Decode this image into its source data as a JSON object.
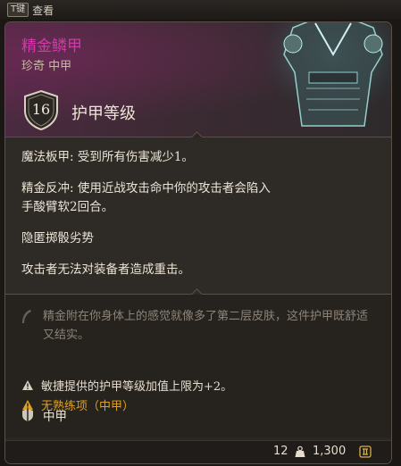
{
  "topbar": {
    "key": "T键",
    "action": "查看"
  },
  "item": {
    "name": "精金鳞甲",
    "rarity_type": "珍奇 中甲",
    "armor_class": "16",
    "armor_class_label": "护甲等级"
  },
  "properties": [
    "魔法板甲: 受到所有伤害减少1。",
    "精金反冲: 使用近战攻击命中你的攻击者会陷入",
    "手酸臂软2回合。",
    "隐匿掷骰劣势",
    "攻击者无法对装备者造成重击。"
  ],
  "flavor": "精金附在你身体上的感觉就像多了第二层皮肤，这件护甲既舒适又结实。",
  "notes": {
    "dex_cap": "敏捷提供的护甲等级加值上限为+2。",
    "proficiency": "无熟练项（中甲）"
  },
  "category": "中甲",
  "footer": {
    "weight": "12",
    "price": "1,300"
  },
  "colors": {
    "name": "#d03aa8",
    "warning": "#e0a020",
    "text": "#ece4d6"
  }
}
